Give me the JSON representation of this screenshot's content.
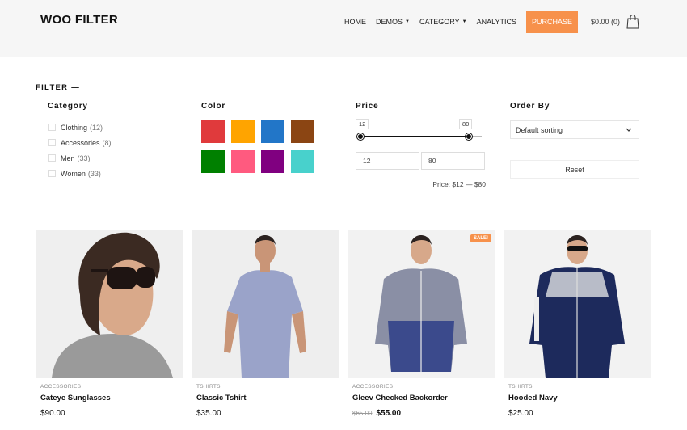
{
  "header": {
    "logo": "WOO FILTER",
    "nav": [
      {
        "label": "HOME",
        "caret": false
      },
      {
        "label": "DEMOS",
        "caret": true
      },
      {
        "label": "CATEGORY",
        "caret": true
      },
      {
        "label": "ANALYTICS",
        "caret": false
      }
    ],
    "purchase_label": "PURCHASE",
    "purchase_color": "#f7914b",
    "cart_label": "$0.00 (0)",
    "cart_icon": "shopping-bag-icon"
  },
  "filter": {
    "title": "FILTER —",
    "category": {
      "title": "Category",
      "items": [
        {
          "label": "Clothing",
          "count": "(12)"
        },
        {
          "label": "Accessories",
          "count": "(8)"
        },
        {
          "label": "Men",
          "count": "(33)"
        },
        {
          "label": "Women",
          "count": "(33)"
        }
      ]
    },
    "color": {
      "title": "Color",
      "swatches": [
        "#e03a3c",
        "#ffa400",
        "#2276c8",
        "#8b4513",
        "#008000",
        "#ff5a7f",
        "#800080",
        "#48d1cc"
      ]
    },
    "price": {
      "title": "Price",
      "min_tip": "12",
      "max_tip": "80",
      "min_value": "12",
      "max_value": "80",
      "range_fraction": [
        0.0,
        0.89
      ],
      "label": "Price: $12 — $80"
    },
    "order": {
      "title": "Order By",
      "selected": "Default sorting",
      "reset_label": "Reset"
    }
  },
  "products": [
    {
      "category": "ACCESSORIES",
      "name": "Cateye Sunglasses",
      "price": "$90.00",
      "old_price": "",
      "sale": ""
    },
    {
      "category": "TSHIRTS",
      "name": "Classic Tshirt",
      "price": "$35.00",
      "old_price": "",
      "sale": ""
    },
    {
      "category": "ACCESSORIES",
      "name": "Gleev Checked Backorder",
      "price": "$55.00",
      "old_price": "$65.00",
      "sale": "SALE!"
    },
    {
      "category": "TSHIRTS",
      "name": "Hooded Navy",
      "price": "$25.00",
      "old_price": "",
      "sale": ""
    }
  ]
}
